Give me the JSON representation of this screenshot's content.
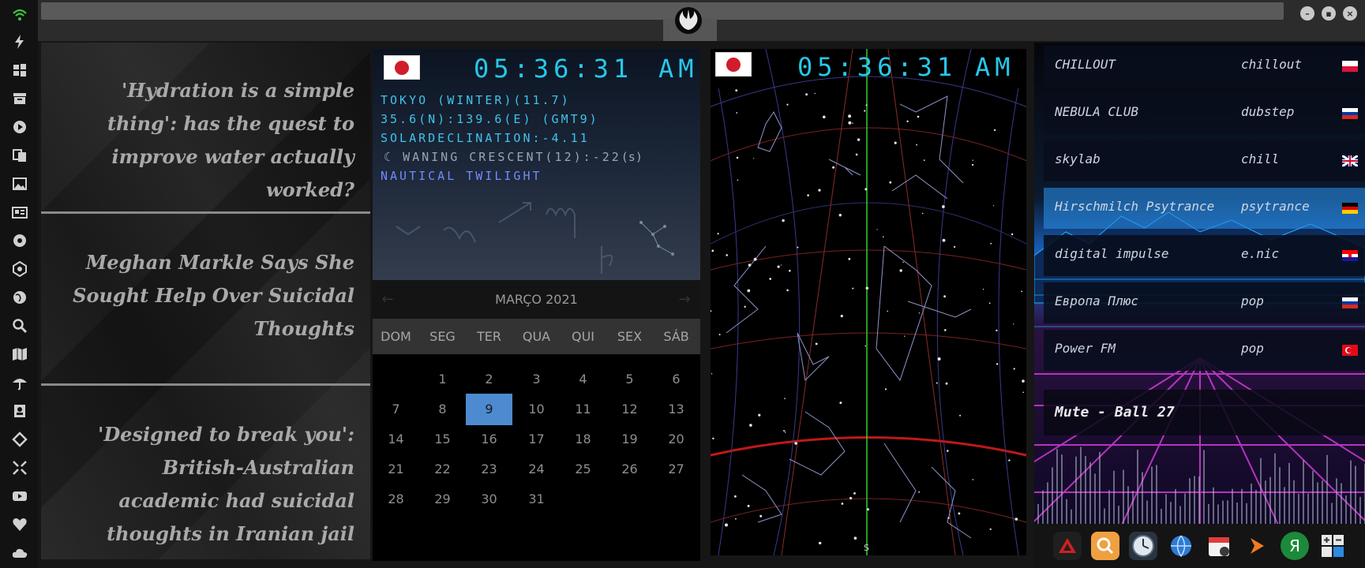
{
  "dock": {
    "icons": [
      "wifi-icon",
      "flash-icon",
      "windows-icon",
      "archive-icon",
      "play-icon",
      "translate-icon",
      "image-icon",
      "news-icon",
      "rebel-icon",
      "chakra-icon",
      "globe-icon",
      "search-icon",
      "map-icon",
      "umbrella-icon",
      "contact-icon",
      "diamond-icon",
      "expand-icon",
      "youtube-icon",
      "heart-icon",
      "cloud-icon"
    ],
    "accent": "#3cc63c"
  },
  "news": {
    "headlines": [
      "'Hydration is a simple thing': has the quest to improve water actually worked?",
      "Meghan Markle Says She Sought Help Over Suicidal Thoughts",
      "'Designed to break you': British-Australian academic had suicidal thoughts in Iranian jail"
    ]
  },
  "clock": {
    "time": "05:36:31",
    "ampm": "AM",
    "location": "TOKYO (WINTER)(11.7)",
    "coords": "35.6(N):139.6(E) (GMT9)",
    "declination": "SOLARDECLINATION:-4.11",
    "moon": "WANING CRESCENT(12):-22",
    "moon_unit": "(s)",
    "twilight": "NAUTICAL TWILIGHT"
  },
  "calendar": {
    "month": "MARÇO 2021",
    "weekdays": [
      "DOM",
      "SEG",
      "TER",
      "QUA",
      "QUI",
      "SEX",
      "SÁB"
    ],
    "weeks": [
      [
        "",
        "1",
        "2",
        "3",
        "4",
        "5",
        "6"
      ],
      [
        "7",
        "8",
        "9",
        "10",
        "11",
        "12",
        "13"
      ],
      [
        "14",
        "15",
        "16",
        "17",
        "18",
        "19",
        "20"
      ],
      [
        "21",
        "22",
        "23",
        "24",
        "25",
        "26",
        "27"
      ],
      [
        "28",
        "29",
        "30",
        "31",
        "",
        "",
        ""
      ]
    ],
    "selected": "9",
    "accent": "#4d8ad0"
  },
  "skymap": {
    "time": "05:36:31",
    "ampm": "AM",
    "direction": "S"
  },
  "radio": {
    "stations": [
      {
        "name": "CHILLOUT",
        "genre": "chillout",
        "flag": "poland"
      },
      {
        "name": "NEBULA CLUB",
        "genre": "dubstep",
        "flag": "russia"
      },
      {
        "name": "skylab",
        "genre": "chill",
        "flag": "uk"
      },
      {
        "name": "Hirschmilch Psytrance",
        "genre": "psytrance",
        "flag": "germany"
      },
      {
        "name": "digital impulse",
        "genre": "e.nic",
        "flag": "croatia"
      },
      {
        "name": "Европа Плюс",
        "genre": "pop",
        "flag": "russia"
      },
      {
        "name": "Power FM",
        "genre": "pop",
        "flag": "turkey"
      }
    ],
    "active_index": 3,
    "now_playing": "Mute - Ball 27"
  },
  "taskbar": {
    "icons": [
      "rebel-app-icon",
      "search-app-icon",
      "clock-app-icon",
      "browser-app-icon",
      "calendar-app-icon",
      "player-app-icon",
      "yandex-app-icon",
      "calculator-app-icon"
    ]
  }
}
